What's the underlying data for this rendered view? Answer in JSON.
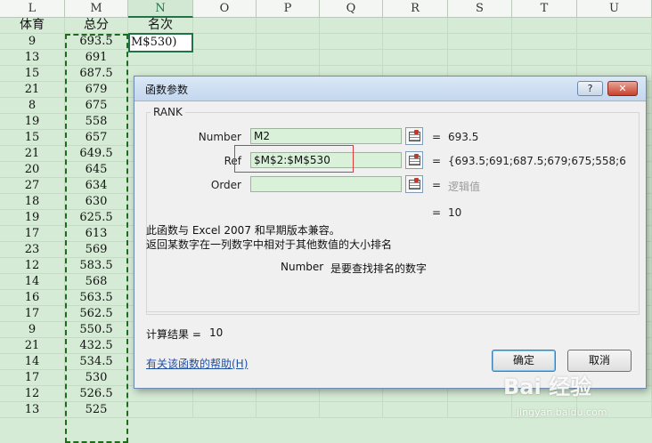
{
  "sheet": {
    "columns": [
      "L",
      "M",
      "N",
      "O",
      "P",
      "Q",
      "R",
      "S",
      "T",
      "U"
    ],
    "header_row": [
      "体育",
      "总分",
      "名次"
    ],
    "rows": [
      [
        "9",
        "693.5"
      ],
      [
        "13",
        "691"
      ],
      [
        "15",
        "687.5"
      ],
      [
        "21",
        "679"
      ],
      [
        "8",
        "675"
      ],
      [
        "19",
        "558"
      ],
      [
        "15",
        "657"
      ],
      [
        "21",
        "649.5"
      ],
      [
        "20",
        "645"
      ],
      [
        "27",
        "634"
      ],
      [
        "18",
        "630"
      ],
      [
        "19",
        "625.5"
      ],
      [
        "17",
        "613"
      ],
      [
        "23",
        "569"
      ],
      [
        "12",
        "583.5"
      ],
      [
        "14",
        "568"
      ],
      [
        "16",
        "563.5"
      ],
      [
        "17",
        "562.5"
      ],
      [
        "9",
        "550.5"
      ],
      [
        "21",
        "432.5"
      ],
      [
        "14",
        "534.5"
      ],
      [
        "17",
        "530"
      ],
      [
        "12",
        "526.5"
      ],
      [
        "13",
        "525"
      ]
    ],
    "active_cell_text": "M$530)"
  },
  "dialog": {
    "title": "函数参数",
    "help_button": "?",
    "close_button": "✕",
    "function_name": "RANK",
    "args": [
      {
        "label": "Number",
        "value": "M2",
        "result": "693.5"
      },
      {
        "label": "Ref",
        "value": "$M$2:$M$530",
        "result": "{693.5;691;687.5;679;675;558;657;6"
      },
      {
        "label": "Order",
        "value": "",
        "result": "逻辑值"
      }
    ],
    "equals": "=",
    "formula_result": "10",
    "description_line1": "此函数与 Excel 2007 和早期版本兼容。",
    "description_line2": "返回某数字在一列数字中相对于其他数值的大小排名",
    "arg_help_name": "Number",
    "arg_help_text": "是要查找排名的数字",
    "calc_result_label": "计算结果 =",
    "calc_result_value": "10",
    "help_link": "有关该函数的帮助(H)",
    "ok_button": "确定",
    "cancel_button": "取消"
  },
  "watermark": {
    "main": "Bai 经验",
    "sub": "jingyan.baidu.com"
  },
  "colors": {
    "sheet_bg": "#d5ebd5",
    "accent": "#217346",
    "highlight_box": "#d63a3a"
  }
}
